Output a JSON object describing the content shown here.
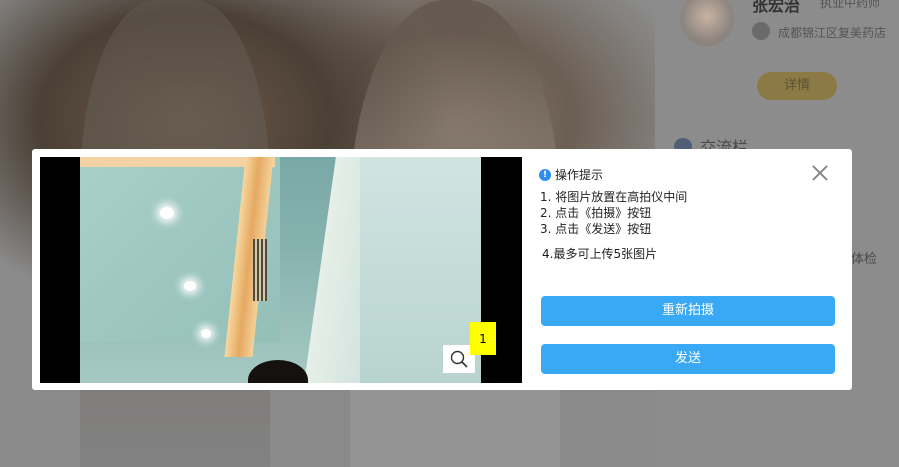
{
  "background": {
    "doctor_name": "张宏治",
    "doctor_title": "执业中药师",
    "address": "成都锦江区复美药店",
    "detail_button": "详情",
    "chat_title": "交流栏",
    "side_text": "体检"
  },
  "modal": {
    "image_count": "1",
    "zoom_icon": "search-icon",
    "tips_title": "操作提示",
    "tips": [
      "1. 将图片放置在高拍仪中间",
      "2. 点击《拍摄》按钮",
      "3. 点击《发送》按钮"
    ],
    "tip4": "4.最多可上传5张图片",
    "retake_button": "重新拍摄",
    "send_button": "发送",
    "accent_color": "#3aa9f5",
    "badge_color": "#ffff00"
  }
}
